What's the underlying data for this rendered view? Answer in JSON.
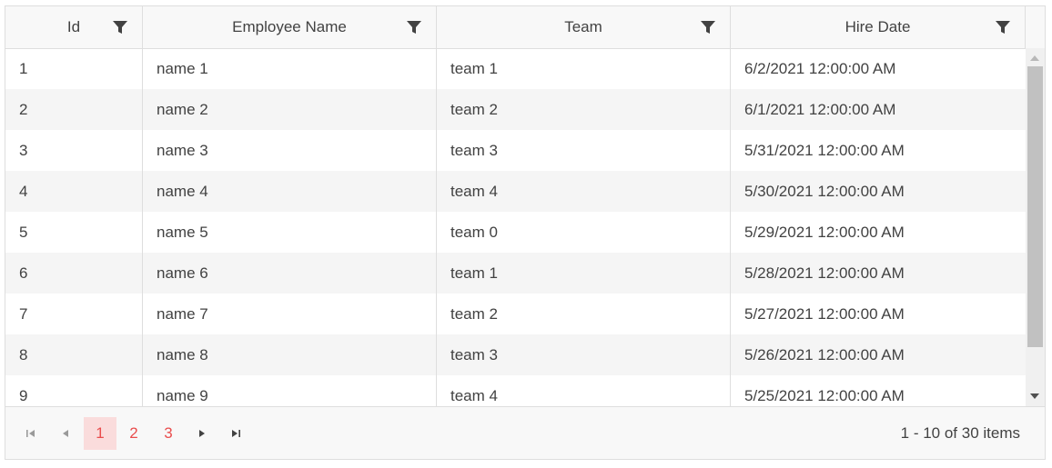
{
  "columns": [
    "Id",
    "Employee Name",
    "Team",
    "Hire Date"
  ],
  "rows": [
    [
      "1",
      "name 1",
      "team 1",
      "6/2/2021 12:00:00 AM"
    ],
    [
      "2",
      "name 2",
      "team 2",
      "6/1/2021 12:00:00 AM"
    ],
    [
      "3",
      "name 3",
      "team 3",
      "5/31/2021 12:00:00 AM"
    ],
    [
      "4",
      "name 4",
      "team 4",
      "5/30/2021 12:00:00 AM"
    ],
    [
      "5",
      "name 5",
      "team 0",
      "5/29/2021 12:00:00 AM"
    ],
    [
      "6",
      "name 6",
      "team 1",
      "5/28/2021 12:00:00 AM"
    ],
    [
      "7",
      "name 7",
      "team 2",
      "5/27/2021 12:00:00 AM"
    ],
    [
      "8",
      "name 8",
      "team 3",
      "5/26/2021 12:00:00 AM"
    ],
    [
      "9",
      "name 9",
      "team 4",
      "5/25/2021 12:00:00 AM"
    ]
  ],
  "pager": {
    "pages": [
      "1",
      "2",
      "3"
    ],
    "current_page": "1",
    "info": "1 - 10 of 30 items"
  },
  "icons": {
    "filter": "filter-icon",
    "first": "first-page-icon",
    "prev": "prev-page-icon",
    "next": "next-page-icon",
    "last": "last-page-icon"
  },
  "colors": {
    "accent": "#e94d4d",
    "active_page_bg": "#fadcdc",
    "alt_row": "#f5f5f5",
    "header_bg": "#f8f8f8"
  }
}
